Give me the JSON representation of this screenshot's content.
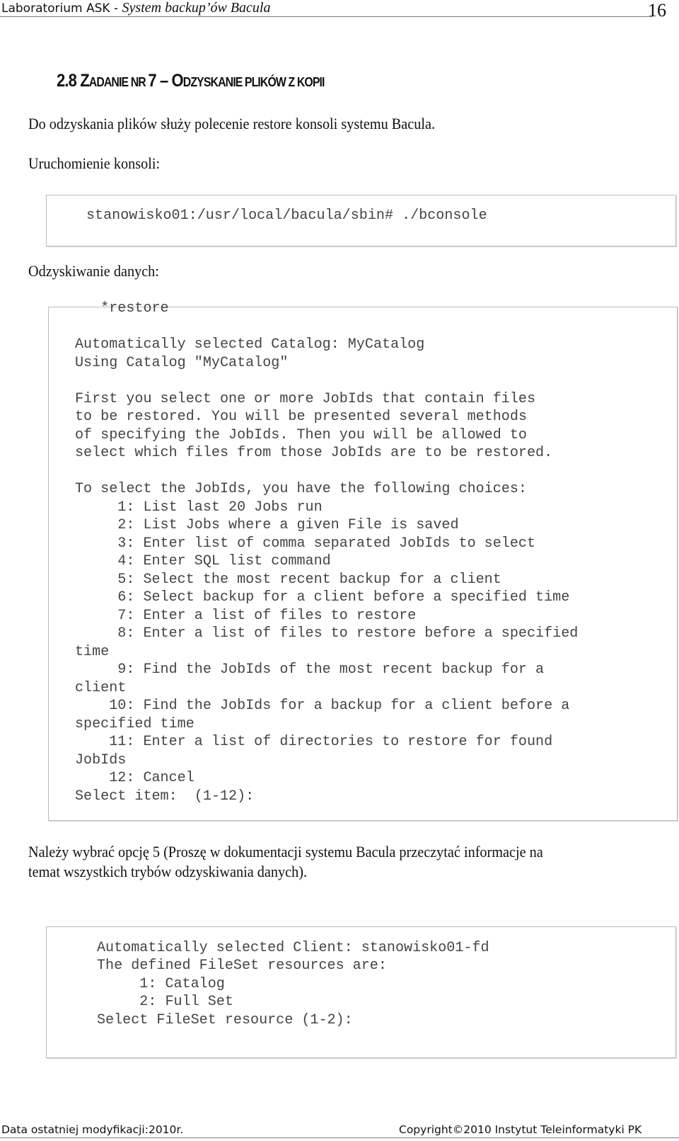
{
  "header": {
    "course": "Laboratorium ASK",
    "separator": " - ",
    "subject": "System backup’ów Bacula",
    "page_number": "16"
  },
  "section": {
    "number": "2.8",
    "title_parts": [
      {
        "text": "Z",
        "size": "big"
      },
      {
        "text": "ADANIE NR ",
        "size": "sm"
      },
      {
        "text": "7 – O",
        "size": "big"
      },
      {
        "text": "DZYSKANIE PLIKÓW Z KOPII",
        "size": "sm"
      }
    ]
  },
  "paragraphs": {
    "intro": "Do odzyskania plików służy polecenie restore konsoli systemu Bacula.",
    "console_label": "Uruchomienie konsoli:",
    "restore_label": "Odzyskiwanie danych:",
    "choice_line1": "Należy wybrać opcję 5 (Proszę w dokumentacji systemu Bacula przeczytać informacje na",
    "choice_line2": "temat wszystkich trybów odzyskiwania danych)."
  },
  "code_blocks": {
    "console": "stanowisko01:/usr/local/bacula/sbin# ./bconsole",
    "restore_lines": [
      "   *restore",
      "",
      "Automatically selected Catalog: MyCatalog",
      "Using Catalog \"MyCatalog\"",
      "",
      "First you select one or more JobIds that contain files",
      "to be restored. You will be presented several methods",
      "of specifying the JobIds. Then you will be allowed to",
      "select which files from those JobIds are to be restored.",
      "",
      "To select the JobIds, you have the following choices:",
      "     1: List last 20 Jobs run",
      "     2: List Jobs where a given File is saved",
      "     3: Enter list of comma separated JobIds to select",
      "     4: Enter SQL list command",
      "     5: Select the most recent backup for a client",
      "     6: Select backup for a client before a specified time",
      "     7: Enter a list of files to restore",
      "     8: Enter a list of files to restore before a specified",
      "time",
      "     9: Find the JobIds of the most recent backup for a",
      "client",
      "    10: Find the JobIds for a backup for a client before a",
      "specified time",
      "    11: Enter a list of directories to restore for found",
      "JobIds",
      "    12: Cancel",
      "Select item:  (1-12):"
    ],
    "fileset_lines": [
      "Automatically selected Client: stanowisko01-fd",
      "The defined FileSet resources are:",
      "     1: Catalog",
      "     2: Full Set",
      "Select FileSet resource (1-2):"
    ]
  },
  "footer": {
    "modified": "Data ostatniej modyfikacji:2010r.",
    "copyright": "Copyright©2010 Instytut Teleinformatyki PK"
  }
}
